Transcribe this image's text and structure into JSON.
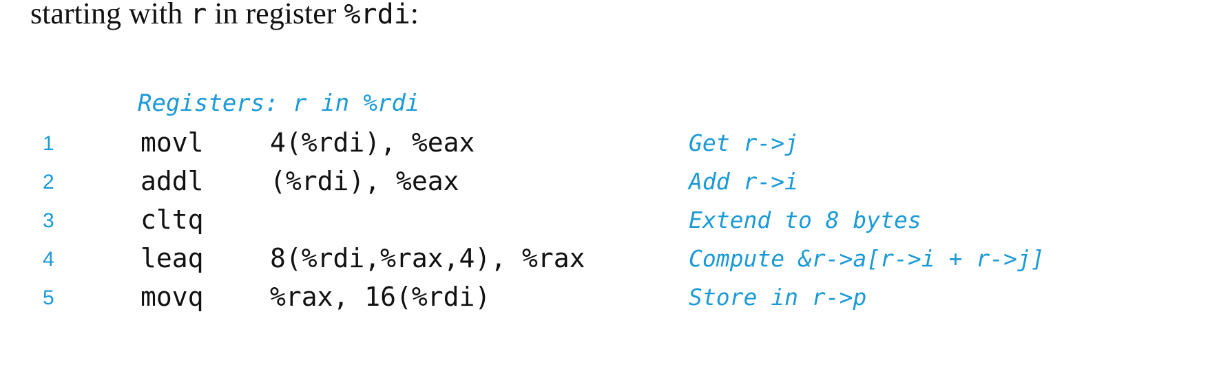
{
  "intro": {
    "text_before": "starting with ",
    "var": "r",
    "text_middle": " in register ",
    "register": "%rdi",
    "text_after": ":"
  },
  "listing": {
    "register_comment": "Registers: r in %rdi",
    "lines": [
      {
        "num": "1",
        "opcode": "movl",
        "operands": "4(%rdi), %eax",
        "comment": "Get r->j"
      },
      {
        "num": "2",
        "opcode": "addl",
        "operands": "(%rdi), %eax",
        "comment": "Add r->i"
      },
      {
        "num": "3",
        "opcode": "cltq",
        "operands": "",
        "comment": "Extend to 8 bytes"
      },
      {
        "num": "4",
        "opcode": "leaq",
        "operands": "8(%rdi,%rax,4), %rax",
        "comment": "Compute &r->a[r->i + r->j]"
      },
      {
        "num": "5",
        "opcode": "movq",
        "operands": "%rax, 16(%rdi)",
        "comment": "Store in r->p"
      }
    ]
  },
  "colors": {
    "comment": "#1a9ad6",
    "text": "#111111"
  }
}
